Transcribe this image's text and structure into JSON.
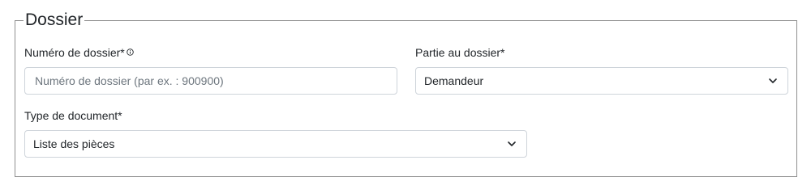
{
  "section": {
    "title": "Dossier"
  },
  "fields": {
    "case_number": {
      "label": "Numéro de dossier*",
      "value": "",
      "placeholder": "Numéro de dossier (par ex. : 900900)",
      "info_icon": "info-circle-icon"
    },
    "party": {
      "label": "Partie au dossier*",
      "selected": "Demandeur",
      "icon": "chevron-down-icon"
    },
    "document_type": {
      "label": "Type de document*",
      "selected": "Liste des pièces",
      "icon": "chevron-down-icon"
    }
  },
  "colors": {
    "border": "#ced4da",
    "fieldset_border": "#8f8f8f",
    "text": "#212529",
    "placeholder": "#6c757d"
  }
}
